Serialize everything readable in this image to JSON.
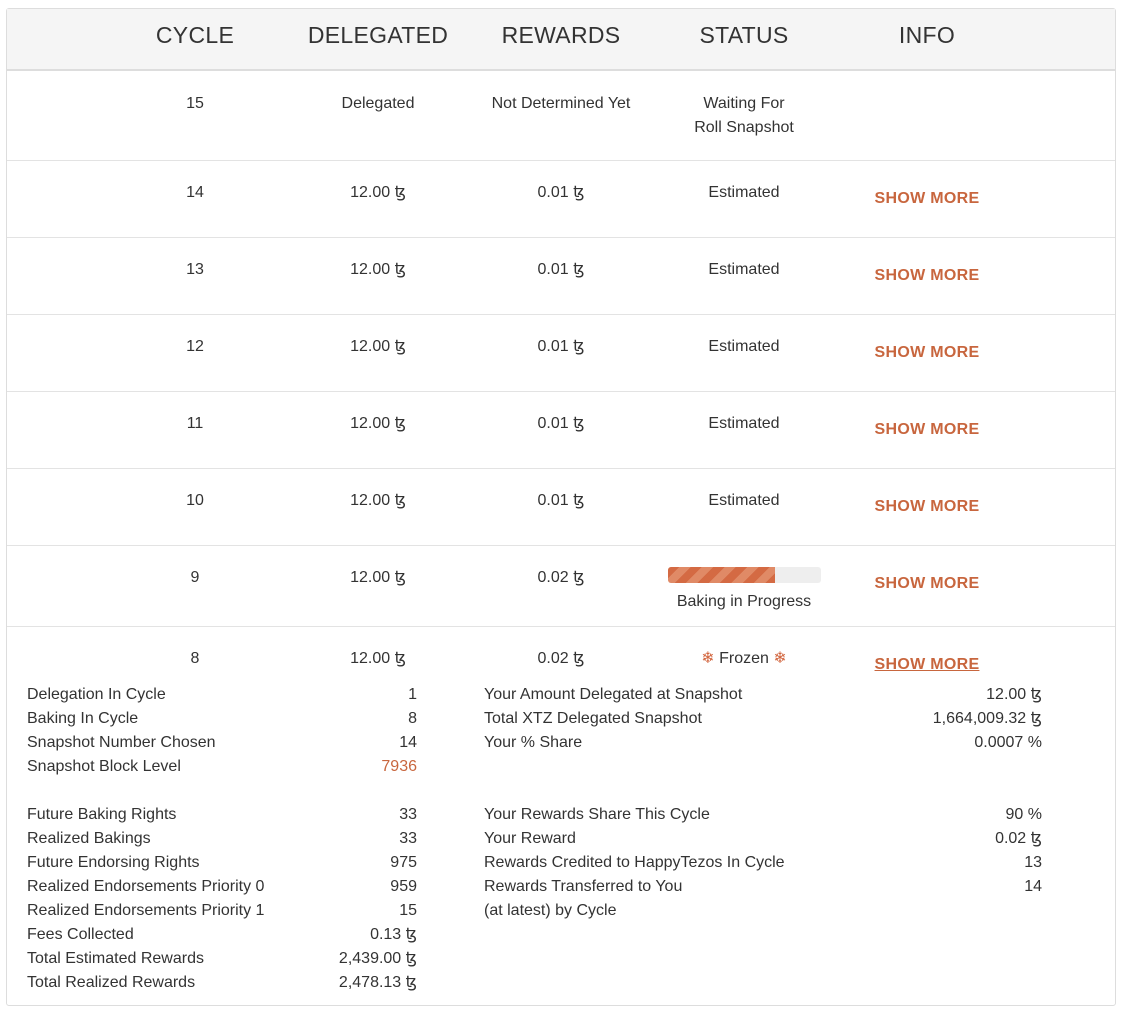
{
  "headers": [
    "CYCLE",
    "DELEGATED",
    "REWARDS",
    "STATUS",
    "INFO"
  ],
  "show_more_label": "SHOW MORE",
  "rows": [
    {
      "cycle": "15",
      "delegated": "Delegated",
      "rewards": "Not Determined Yet",
      "status_line1": "Waiting For",
      "status_line2": "Roll Snapshot"
    },
    {
      "cycle": "14",
      "delegated": "12.00 ꜩ",
      "rewards": "0.01 ꜩ",
      "status": "Estimated"
    },
    {
      "cycle": "13",
      "delegated": "12.00 ꜩ",
      "rewards": "0.01 ꜩ",
      "status": "Estimated"
    },
    {
      "cycle": "12",
      "delegated": "12.00 ꜩ",
      "rewards": "0.01 ꜩ",
      "status": "Estimated"
    },
    {
      "cycle": "11",
      "delegated": "12.00 ꜩ",
      "rewards": "0.01 ꜩ",
      "status": "Estimated"
    },
    {
      "cycle": "10",
      "delegated": "12.00 ꜩ",
      "rewards": "0.01 ꜩ",
      "status": "Estimated"
    },
    {
      "cycle": "9",
      "delegated": "12.00 ꜩ",
      "rewards": "0.02 ꜩ",
      "status": "Baking in Progress",
      "progress": 0.7
    },
    {
      "cycle": "8",
      "delegated": "12.00 ꜩ",
      "rewards": "0.02 ꜩ",
      "status": "Frozen",
      "status_icon": "snowflake-icon"
    }
  ],
  "detail": {
    "left_group1": [
      {
        "label": "Delegation In Cycle",
        "value": "1"
      },
      {
        "label": "Baking In Cycle",
        "value": "8"
      },
      {
        "label": "Snapshot Number Chosen",
        "value": "14"
      },
      {
        "label": "Snapshot Block Level",
        "value": "7936"
      }
    ],
    "left_group2": [
      {
        "label": "Future Baking Rights",
        "value": "33"
      },
      {
        "label": "Realized Bakings",
        "value": "33"
      },
      {
        "label": "Future Endorsing Rights",
        "value": "975"
      },
      {
        "label": "Realized Endorsements Priority 0",
        "value": "959"
      },
      {
        "label": "Realized Endorsements Priority 1",
        "value": "15"
      },
      {
        "label": "Fees Collected",
        "value": "0.13 ꜩ"
      },
      {
        "label": "Total Estimated Rewards",
        "value": "2,439.00 ꜩ"
      },
      {
        "label": "Total Realized Rewards",
        "value": "2,478.13 ꜩ"
      }
    ],
    "right_group1": [
      {
        "label": "Your Amount Delegated at Snapshot",
        "value": "12.00 ꜩ"
      },
      {
        "label": "Total XTZ Delegated Snapshot",
        "value": "1,664,009.32 ꜩ"
      },
      {
        "label": "Your % Share",
        "value": "0.0007 %"
      }
    ],
    "right_group2": [
      {
        "label": "Your Rewards Share This Cycle",
        "value": "90 %"
      },
      {
        "label": "Your Reward",
        "value": "0.02 ꜩ"
      },
      {
        "label": "Rewards Credited to HappyTezos In Cycle",
        "value": "13"
      },
      {
        "label": "Rewards Transferred to You",
        "value": "14"
      },
      {
        "label": "(at latest) by Cycle",
        "value": ""
      }
    ]
  },
  "colors": {
    "accent": "#c8663e",
    "header_bg": "#f5f5f5",
    "border": "#dddddd"
  }
}
